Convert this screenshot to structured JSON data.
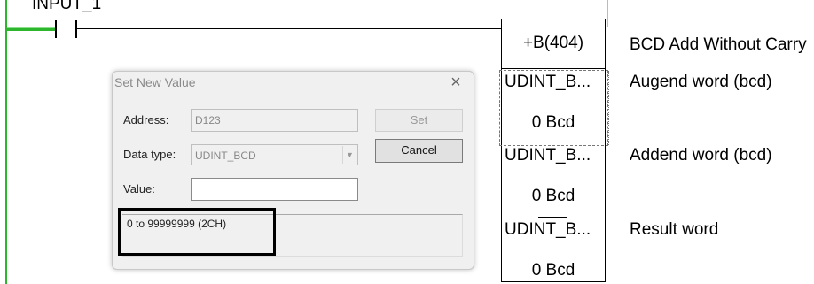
{
  "ladder": {
    "input_label": "INPUT_1",
    "instruction": {
      "title": "+B(404)",
      "description": "BCD Add Without Carry",
      "operands": [
        {
          "type": "UDINT_B...",
          "value": "0 Bcd",
          "description": "Augend word (bcd)"
        },
        {
          "type": "UDINT_B...",
          "value": "0 Bcd",
          "description": "Addend word (bcd)"
        },
        {
          "type": "UDINT_B...",
          "value": "0 Bcd",
          "description": "Result word"
        }
      ]
    }
  },
  "dialog": {
    "title": "Set New Value",
    "close_icon": "×",
    "address_label": "Address:",
    "address_value": "D123",
    "data_type_label": "Data type:",
    "data_type_value": "UDINT_BCD",
    "value_label": "Value:",
    "value_value": "",
    "set_button": "Set",
    "cancel_button": "Cancel",
    "range_text": "0 to 99999999 (2CH)"
  },
  "colors": {
    "power_flow": "#2db52d",
    "dialog_bg": "#f0f0f0",
    "highlight": "#000000"
  }
}
